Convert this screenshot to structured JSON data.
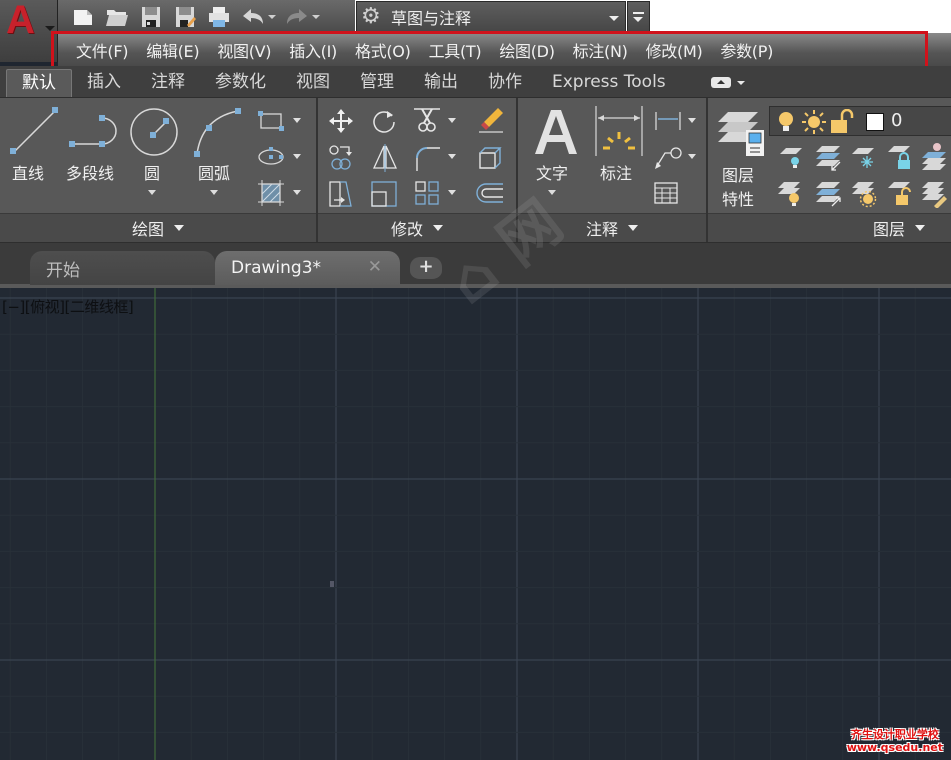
{
  "app": {
    "logo_letter": "A",
    "workspace": "草图与注释"
  },
  "qat": {
    "icons": [
      "new-file-icon",
      "open-folder-icon",
      "save-icon",
      "save-as-icon",
      "plot-icon",
      "undo-icon",
      "redo-icon"
    ]
  },
  "menubar": {
    "items": [
      "文件(F)",
      "编辑(E)",
      "视图(V)",
      "插入(I)",
      "格式(O)",
      "工具(T)",
      "绘图(D)",
      "标注(N)",
      "修改(M)",
      "参数(P)"
    ],
    "highlight_color": "#d0121b"
  },
  "ribbon_tabs": {
    "items": [
      "默认",
      "插入",
      "注释",
      "参数化",
      "视图",
      "管理",
      "输出",
      "协作",
      "Express Tools"
    ],
    "active": "默认"
  },
  "panels": {
    "draw": {
      "title": "绘图",
      "tools": [
        "直线",
        "多段线",
        "圆",
        "圆弧"
      ]
    },
    "modify": {
      "title": "修改"
    },
    "annotation": {
      "title": "注释",
      "tools": [
        "文字",
        "标注"
      ]
    },
    "layers": {
      "title": "图层",
      "properties_line1": "图层",
      "properties_line2": "特性",
      "current_layer": "0"
    }
  },
  "file_tabs": {
    "items": [
      "开始",
      "Drawing3*"
    ],
    "active": "Drawing3*",
    "close_glyph": "✕",
    "add_glyph": "+"
  },
  "canvas": {
    "viewport_label": "[−][俯视][二维线框]",
    "background": "#222933",
    "watermark_line1": "齐生设计职业学校",
    "watermark_line2": "www.qsedu.net",
    "bg_watermark": "⌂ 网"
  }
}
